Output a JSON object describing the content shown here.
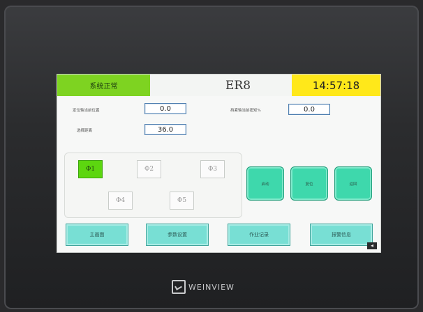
{
  "header": {
    "status": "系统正常",
    "title": "ER8",
    "clock": "14:57:18"
  },
  "fields": {
    "left_top_label": "定位轴当前位置",
    "left_top_value": "0.0",
    "left_bottom_label": "选择距离",
    "left_bottom_value": "36.0",
    "right_label": "挡紧轴当前扭矩%",
    "right_value": "0.0"
  },
  "diameters": [
    "Φ1",
    "Φ2",
    "Φ3",
    "Φ4",
    "Φ5"
  ],
  "controls": {
    "start": "启动",
    "reset": "复位",
    "back": "返回"
  },
  "nav": [
    "主画面",
    "参数设置",
    "作业记录",
    "报警信息"
  ],
  "brand": "WEINVIEW",
  "colors": {
    "status_ok": "#7ed321",
    "clock_bg": "#ffe81a",
    "selected": "#5cd60f",
    "control_btn": "#3ed8ac",
    "nav_btn": "#78dfd4"
  }
}
